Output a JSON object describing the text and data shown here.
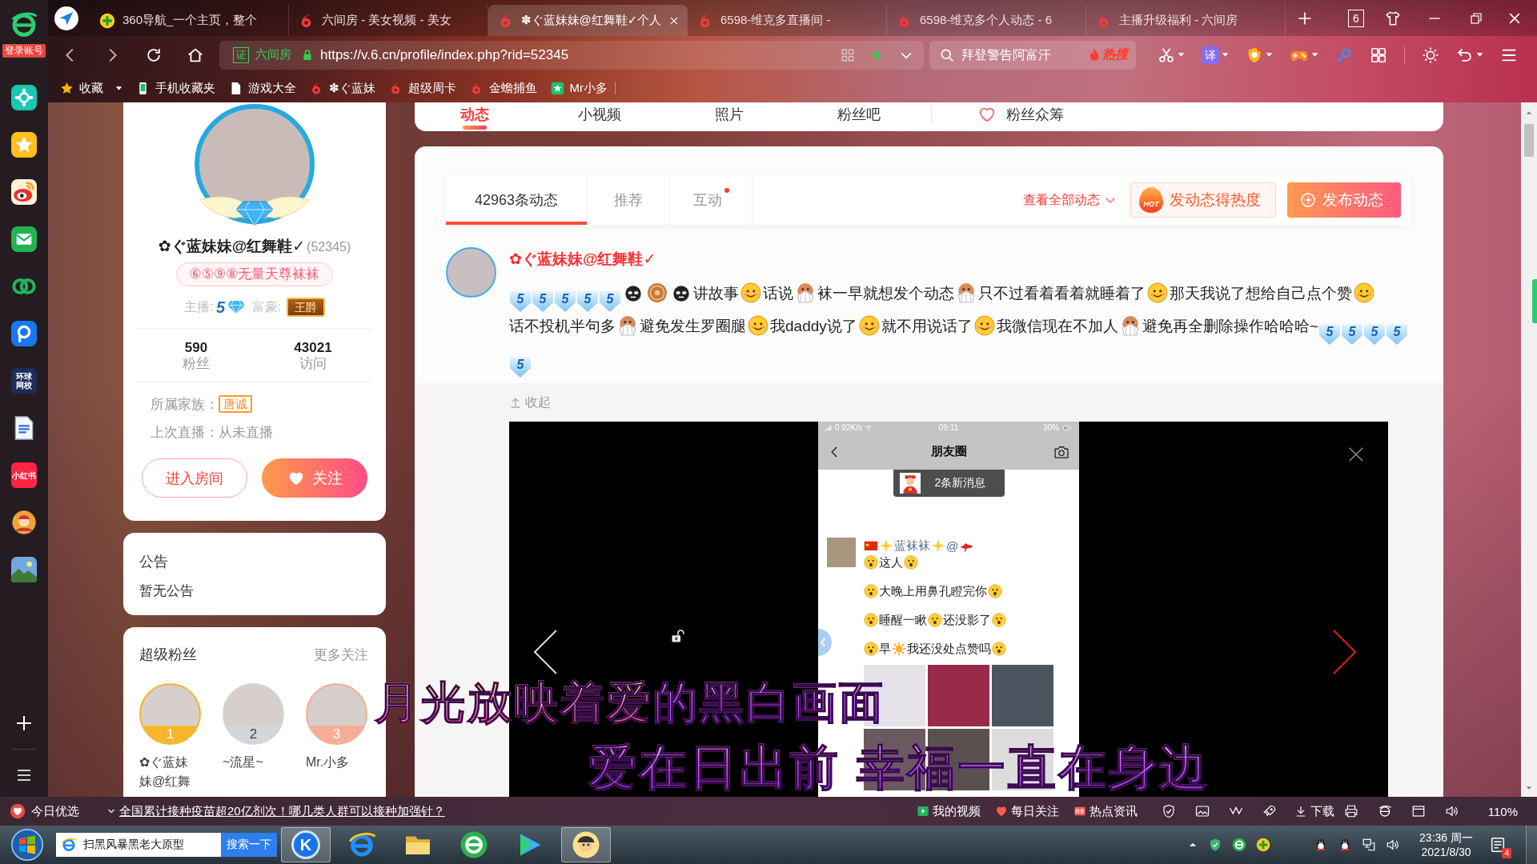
{
  "sidebar": {
    "login_label": "登录账号",
    "apps": [
      {
        "kind": "cross"
      },
      {
        "kind": "star"
      },
      {
        "kind": "eye"
      },
      {
        "kind": "envelope"
      },
      {
        "kind": "rings"
      },
      {
        "kind": "bubble"
      },
      {
        "kind": "label",
        "label": "环球网校",
        "color": "#1d2d5c"
      },
      {
        "kind": "document"
      },
      {
        "kind": "label",
        "label": "小红书",
        "color": "#ff2442"
      },
      {
        "kind": "game"
      },
      {
        "kind": "landscape"
      }
    ]
  },
  "tabs": [
    {
      "title": "360导航_一个主页，整个",
      "kind": "nav",
      "selected": false
    },
    {
      "title": "六间房 - 美女视频 - 美女",
      "kind": "site",
      "selected": false
    },
    {
      "title": "✽ぐ蓝妹妹@红舞鞋✓个人",
      "kind": "site",
      "selected": true
    },
    {
      "title": "6598-维克多直播间 -",
      "kind": "site",
      "selected": false
    },
    {
      "title": "6598-维克多个人动态 - 6",
      "kind": "site",
      "selected": false
    },
    {
      "title": "主播升级福利 - 六间房",
      "kind": "site",
      "selected": false
    }
  ],
  "tab_count": "6",
  "address_bar": {
    "cert_badge": "证",
    "site_label": "六间房",
    "url": "https://v.6.cn/profile/index.php?rid=52345"
  },
  "search": {
    "placeholder": "拜登警告阿富汗",
    "hot_label": "热搜"
  },
  "toolbar": {
    "translate_label": "译"
  },
  "bookmarks": [
    {
      "label": "收藏",
      "kind": "star",
      "menu": true
    },
    {
      "label": "手机收藏夹",
      "kind": "phone",
      "menu": false
    },
    {
      "label": "游戏大全",
      "kind": "page",
      "menu": false
    },
    {
      "label": "✽ぐ蓝妹",
      "kind": "site",
      "menu": false
    },
    {
      "label": "超级周卡",
      "kind": "site",
      "menu": false
    },
    {
      "label": "金蟾捕鱼",
      "kind": "site",
      "menu": false
    },
    {
      "label": "Mr小多",
      "kind": "app",
      "menu": false
    }
  ],
  "profile": {
    "name": "✿ぐ蓝妹妹@红舞鞋✓",
    "id": "(52345)",
    "tag": "⑥⑤⑨⑧无量天尊袜袜",
    "anchor_label": "主播:",
    "anchor_level": "5",
    "wealth_label": "富豪:",
    "wealth_title": "王爵",
    "stats": [
      {
        "value": "590",
        "label": "粉丝"
      },
      {
        "value": "43021",
        "label": "访问"
      }
    ],
    "family_label": "所属家族：",
    "family": "唐诚",
    "last_live": "上次直播：从未直播",
    "enter_button": "进入房间",
    "follow_button": "关注"
  },
  "notice": {
    "title": "公告",
    "text": "暂无公告"
  },
  "super_fans": {
    "title": "超级粉丝",
    "more": "更多关注",
    "fans": [
      {
        "rank": "1",
        "name": "✿ぐ蓝妹妹@红舞",
        "color": "#f7b52c"
      },
      {
        "rank": "2",
        "name": "~流星~",
        "color": "#d3d6db"
      },
      {
        "rank": "3",
        "name": "Mr.小多",
        "color": "#f6ad95"
      }
    ]
  },
  "profile_nav": [
    {
      "label": "动态",
      "kind": "plain",
      "selected": true
    },
    {
      "label": "小视频",
      "kind": "plain",
      "selected": false
    },
    {
      "label": "照片",
      "kind": "plain",
      "selected": false
    },
    {
      "label": "粉丝吧",
      "kind": "plain",
      "selected": false
    },
    {
      "label": "粉丝众筹",
      "kind": "heart",
      "selected": false
    }
  ],
  "feed": {
    "tabs": [
      {
        "label": "42963条动态",
        "selected": true,
        "dot": false
      },
      {
        "label": "推荐",
        "selected": false,
        "dot": false
      },
      {
        "label": "互动",
        "selected": false,
        "dot": true
      }
    ],
    "view_all": "查看全部动态",
    "hot_badge": "HOT",
    "hot_button": "发动态得热度",
    "post_button": "发布动态",
    "post": {
      "author": "✿ぐ蓝妹妹@红舞鞋✓",
      "content": [
        {
          "kind": "level",
          "text": "5"
        },
        {
          "kind": "level",
          "text": "5"
        },
        {
          "kind": "level",
          "text": "5"
        },
        {
          "kind": "level",
          "text": "5"
        },
        {
          "kind": "level",
          "text": "5"
        },
        {
          "kind": "meme"
        },
        {
          "kind": "coin"
        },
        {
          "kind": "meme"
        },
        {
          "kind": "text",
          "text": "讲故事"
        },
        {
          "kind": "face"
        },
        {
          "kind": "text",
          "text": "话说"
        },
        {
          "kind": "fan"
        },
        {
          "kind": "text",
          "text": "袜一早就想发个动态"
        },
        {
          "kind": "fan"
        },
        {
          "kind": "text",
          "text": "只不过看着看着就睡着了"
        },
        {
          "kind": "face"
        },
        {
          "kind": "text",
          "text": "那天我说了想给自己点个赞"
        },
        {
          "kind": "face"
        },
        {
          "kind": "text",
          "text": "话不投机半句多"
        },
        {
          "kind": "fan"
        },
        {
          "kind": "text",
          "text": "避免发生罗圈腿"
        },
        {
          "kind": "face"
        },
        {
          "kind": "text",
          "text": "我daddy说了"
        },
        {
          "kind": "face"
        },
        {
          "kind": "text",
          "text": "就不用说话了"
        },
        {
          "kind": "face"
        },
        {
          "kind": "text",
          "text": "我微信现在不加人"
        },
        {
          "kind": "fan"
        },
        {
          "kind": "text",
          "text": "避免再全删除操作哈哈哈~"
        },
        {
          "kind": "level",
          "text": "5"
        },
        {
          "kind": "level",
          "text": "5"
        },
        {
          "kind": "level",
          "text": "5"
        },
        {
          "kind": "level",
          "text": "5"
        },
        {
          "kind": "level",
          "text": "5"
        }
      ],
      "collapse": "收起",
      "screenshot": {
        "network_speed": "0.92K/s",
        "time": "09:11",
        "battery": "30%",
        "title": "朋友圈",
        "new_messages": "2条新消息",
        "poster": [
          {
            "kind": "flag"
          },
          {
            "kind": "sparkle"
          },
          {
            "kind": "text",
            "text": "蓝袜袜"
          },
          {
            "kind": "sparkle"
          },
          {
            "kind": "text",
            "text": "@"
          },
          {
            "kind": "heel"
          }
        ],
        "lines": [
          {
            "parts": [
              {
                "kind": "emoji"
              },
              {
                "kind": "text",
                "text": "这人"
              },
              {
                "kind": "emoji"
              }
            ]
          },
          {
            "parts": [
              {
                "kind": "emoji"
              },
              {
                "kind": "text",
                "text": "大晚上用鼻孔瞪完你"
              },
              {
                "kind": "emoji"
              }
            ]
          },
          {
            "parts": [
              {
                "kind": "emoji"
              },
              {
                "kind": "text",
                "text": "睡醒一瞅"
              },
              {
                "kind": "emoji"
              },
              {
                "kind": "text",
                "text": "还没影了"
              },
              {
                "kind": "emoji"
              }
            ]
          },
          {
            "parts": [
              {
                "kind": "emoji"
              },
              {
                "kind": "text",
                "text": "早"
              },
              {
                "kind": "sun"
              },
              {
                "kind": "text",
                "text": "我还没处点赞吗"
              },
              {
                "kind": "emoji"
              }
            ]
          }
        ]
      }
    }
  },
  "lyrics": [
    {
      "parts": [
        {
          "text": "月光放映着爱",
          "sung": true
        },
        {
          "text": "的黑白画面",
          "sung": false
        }
      ]
    },
    {
      "parts": [
        {
          "text": "爱在日出前 幸福一直在身边",
          "sung": false
        }
      ]
    }
  ],
  "status_bar": {
    "left_label": "今日优选",
    "headline": "全国累计接种疫苗超20亿剂次！哪几类人群可以接种加强针？",
    "links": [
      {
        "label": "我的视频",
        "kind": "video"
      },
      {
        "label": "每日关注",
        "kind": "heart"
      },
      {
        "label": "热点资讯",
        "kind": "news"
      }
    ],
    "download": "下载",
    "zoom": "110%"
  },
  "taskbar": {
    "search_value": "扫黑风暴黑老大原型",
    "search_button": "搜索一下",
    "apps": [
      {
        "kind": "letter",
        "label": "K",
        "active": true
      },
      {
        "kind": "ie",
        "active": false
      },
      {
        "kind": "folder",
        "active": false
      },
      {
        "kind": "browser",
        "active": false
      },
      {
        "kind": "player",
        "active": false
      },
      {
        "kind": "avatar",
        "active": true
      }
    ],
    "time": "23:36 周一",
    "date": "2021/8/30",
    "notifications": "4"
  }
}
